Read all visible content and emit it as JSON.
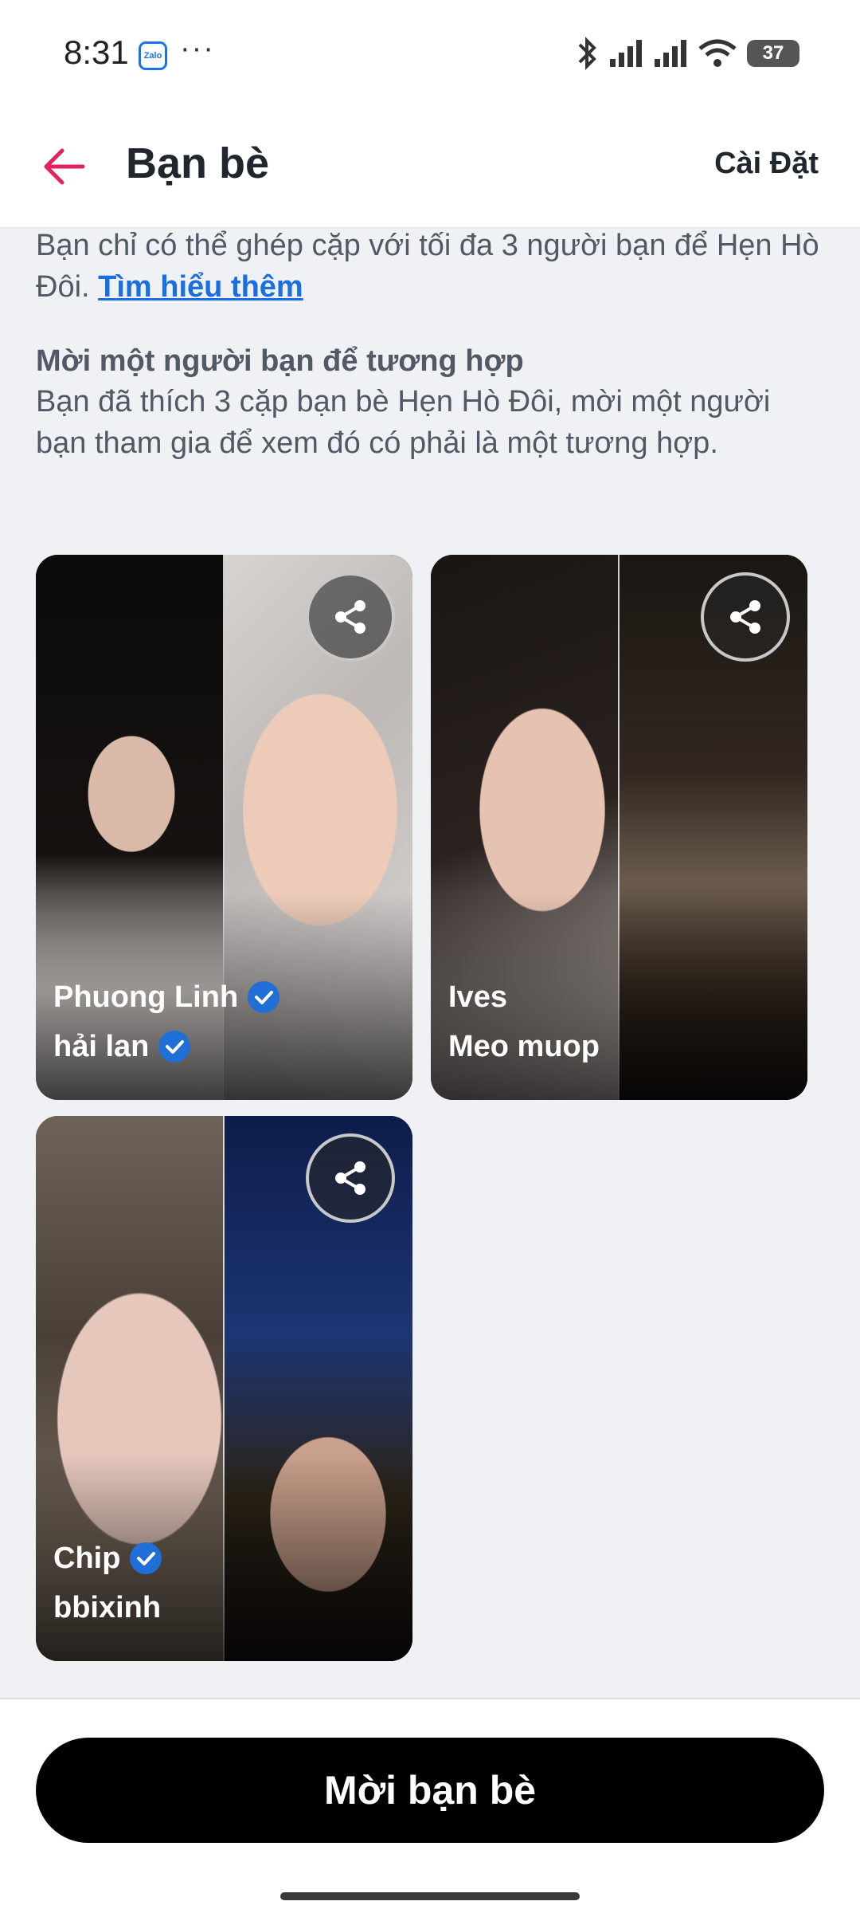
{
  "status_bar": {
    "time": "8:31",
    "app_badge": "Zalo",
    "more": "···",
    "battery": "37"
  },
  "header": {
    "title": "Bạn bè",
    "settings_label": "Cài Đặt"
  },
  "intro": {
    "text": "Bạn chỉ có thể ghép cặp với tối đa 3 người bạn để Hẹn Hò Đôi.",
    "link": "Tìm hiểu thêm"
  },
  "invite_section": {
    "heading": "Mời một người bạn để tương hợp",
    "description": "Bạn đã thích 3 cặp bạn bè Hẹn Hò Đôi, mời một người bạn tham gia để xem đó có phải là một tương hợp."
  },
  "pairs": [
    {
      "name1": "Phuong Linh",
      "name2": "hải lan"
    },
    {
      "name1": "Ives",
      "name2": "Meo muop"
    },
    {
      "name1": "Chip",
      "name2": "bbixinh"
    }
  ],
  "bottom": {
    "invite_button": "Mời bạn bè"
  },
  "colors": {
    "accent": "#e0245e",
    "link": "#1a6fe0",
    "verified": "#1f6fd6"
  }
}
